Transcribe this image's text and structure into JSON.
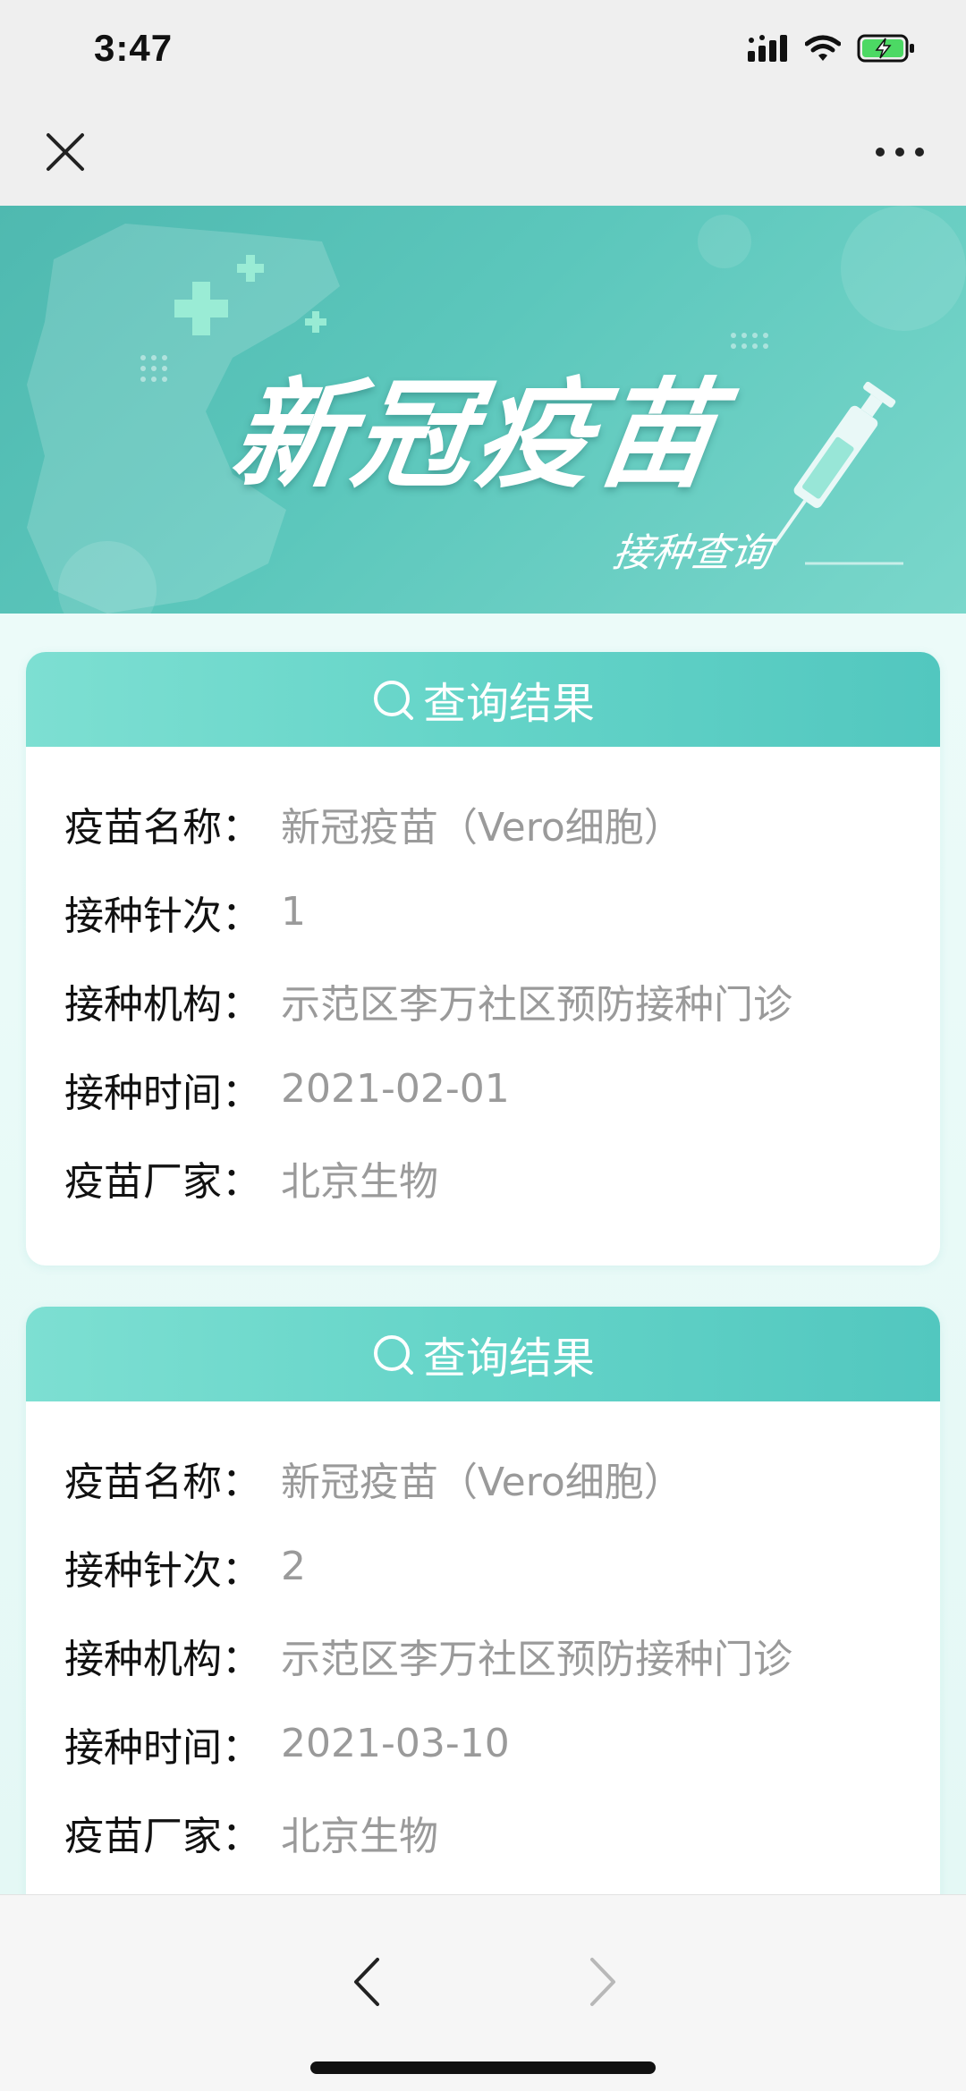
{
  "status_bar": {
    "time": "3:47"
  },
  "banner": {
    "title": "新冠疫苗",
    "subtitle": "接种查询"
  },
  "records": [
    {
      "header": "查询结果",
      "fields": [
        {
          "label": "疫苗名称：",
          "value": "新冠疫苗（Vero细胞）"
        },
        {
          "label": "接种针次：",
          "value": "1"
        },
        {
          "label": "接种机构：",
          "value": "示范区李万社区预防接种门诊"
        },
        {
          "label": "接种时间：",
          "value": "2021-02-01"
        },
        {
          "label": "疫苗厂家：",
          "value": "北京生物"
        }
      ]
    },
    {
      "header": "查询结果",
      "fields": [
        {
          "label": "疫苗名称：",
          "value": "新冠疫苗（Vero细胞）"
        },
        {
          "label": "接种针次：",
          "value": "2"
        },
        {
          "label": "接种机构：",
          "value": "示范区李万社区预防接种门诊"
        },
        {
          "label": "接种时间：",
          "value": "2021-03-10"
        },
        {
          "label": "疫苗厂家：",
          "value": "北京生物"
        }
      ]
    }
  ],
  "icons": {
    "close": "close-icon",
    "more": "more-icon",
    "search": "search-icon",
    "back": "chevron-left-icon",
    "forward": "chevron-right-icon",
    "signal": "cellular-signal-icon",
    "wifi": "wifi-icon",
    "battery": "battery-charging-icon"
  },
  "colors": {
    "accent": "#5cc7bc",
    "header_gradient_start": "#7ddfd2",
    "header_gradient_end": "#52c7bf",
    "label": "#111111",
    "value": "#9a9a9a",
    "battery_green": "#4cd964"
  }
}
